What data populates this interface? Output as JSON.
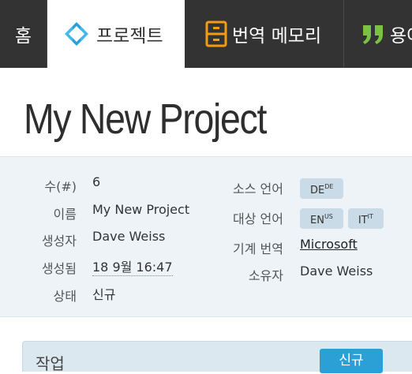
{
  "nav": {
    "home": "홈",
    "projects": "프로젝트",
    "translation_memory": "번역 메모리",
    "termbase": "용어집"
  },
  "page": {
    "title": "My New Project"
  },
  "details": {
    "number_label": "수(#)",
    "number_value": "6",
    "name_label": "이름",
    "name_value": "My New Project",
    "creator_label": "생성자",
    "creator_value": "Dave Weiss",
    "created_label": "생성됨",
    "created_value": "18 9월 16:47",
    "status_label": "상태",
    "status_value": "신규",
    "source_label": "소스 언어",
    "source_languages": [
      {
        "code": "DE",
        "sup": "DE"
      }
    ],
    "target_label": "대상 언어",
    "target_languages": [
      {
        "code": "EN",
        "sup": "US"
      },
      {
        "code": "IT",
        "sup": "IT"
      }
    ],
    "mt_label": "기계 번역",
    "mt_value": "Microsoft",
    "owner_label": "소유자",
    "owner_value": "Dave Weiss"
  },
  "tasks": {
    "title": "작업",
    "new_button": "신규"
  },
  "colors": {
    "nav_bg": "#333333",
    "accent": "#2ba0d6",
    "panel_bg": "#eef3f7",
    "chip_bg": "#c9dbe6",
    "tm_icon": "#f39c12",
    "term_icon": "#7cc242"
  },
  "icons": {
    "projects": "diamond-arrows-icon",
    "translation_memory": "cabinet-icon",
    "termbase": "quote-icon"
  }
}
